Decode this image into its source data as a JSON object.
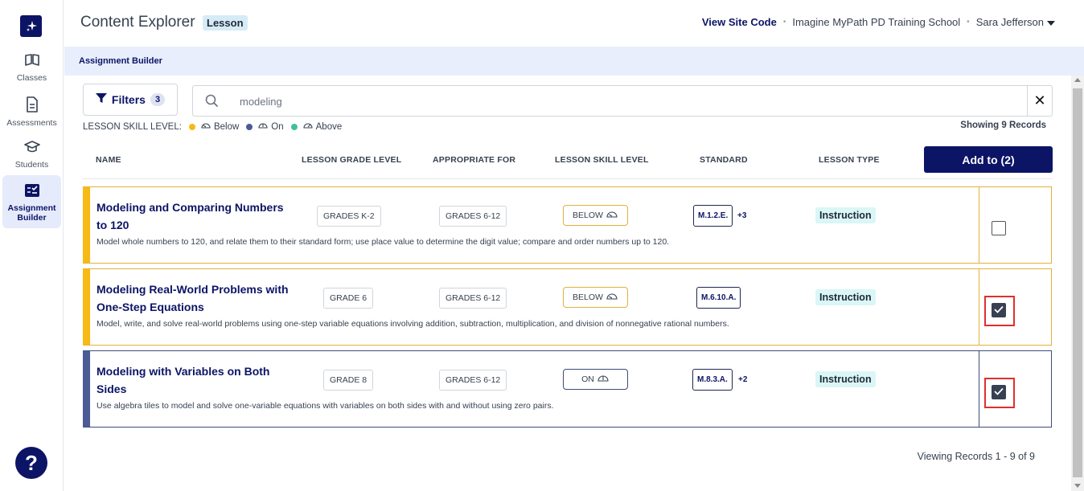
{
  "sidebar": {
    "items": [
      {
        "label": "Classes",
        "icon": "book-open-icon"
      },
      {
        "label": "Assessments",
        "icon": "document-icon"
      },
      {
        "label": "Students",
        "icon": "graduation-cap-icon"
      },
      {
        "label": "Assignment Builder",
        "icon": "checklist-icon"
      }
    ],
    "help": "?"
  },
  "header": {
    "title": "Content Explorer",
    "badge": "Lesson",
    "site_code": "View Site Code",
    "school": "Imagine MyPath PD Training School",
    "user": "Sara  Jefferson"
  },
  "breadcrumb": "Assignment Builder",
  "filters": {
    "label": "Filters",
    "count": "3"
  },
  "search": {
    "value": "modeling"
  },
  "legend": {
    "title": "LESSON SKILL LEVEL:",
    "below": "Below",
    "on": "On",
    "above": "Above",
    "colors": {
      "below": "#f6b916",
      "on": "#4a5b95",
      "above": "#3fbfa0"
    }
  },
  "showing": "Showing 9 Records",
  "table": {
    "headers": {
      "name": "NAME",
      "grade": "LESSON GRADE LEVEL",
      "appropriate": "APPROPRIATE FOR",
      "skill": "LESSON SKILL LEVEL",
      "standard": "STANDARD",
      "type": "LESSON TYPE"
    },
    "add_button": "Add to (2)",
    "rows": [
      {
        "name": "Modeling and Comparing Numbers to 120",
        "description": "Model whole numbers to 120, and relate them to their standard form; use place value to determine the digit value; compare and order numbers up to 120.",
        "grade": "GRADES K-2",
        "appropriate": "GRADES 6-12",
        "skill": "BELOW",
        "standard": "M.1.2.E.",
        "more": "+3",
        "type": "Instruction",
        "checked": false
      },
      {
        "name": "Modeling Real-World Problems with One-Step Equations",
        "description": "Model, write, and solve real-world problems using one-step variable equations involving addition, subtraction, multiplication, and division of nonnegative rational numbers.",
        "grade": "GRADE 6",
        "appropriate": "GRADES 6-12",
        "skill": "BELOW",
        "standard": "M.6.10.A.",
        "more": "",
        "type": "Instruction",
        "checked": true
      },
      {
        "name": "Modeling with Variables on Both Sides",
        "description": "Use algebra tiles to model and solve one-variable equations with variables on both sides with and without using zero pairs.",
        "grade": "GRADE 8",
        "appropriate": "GRADES 6-12",
        "skill": "ON",
        "standard": "M.8.3.A.",
        "more": "+2",
        "type": "Instruction",
        "checked": true
      }
    ]
  },
  "footer": {
    "viewing": "Viewing Records 1 - 9 of 9"
  }
}
